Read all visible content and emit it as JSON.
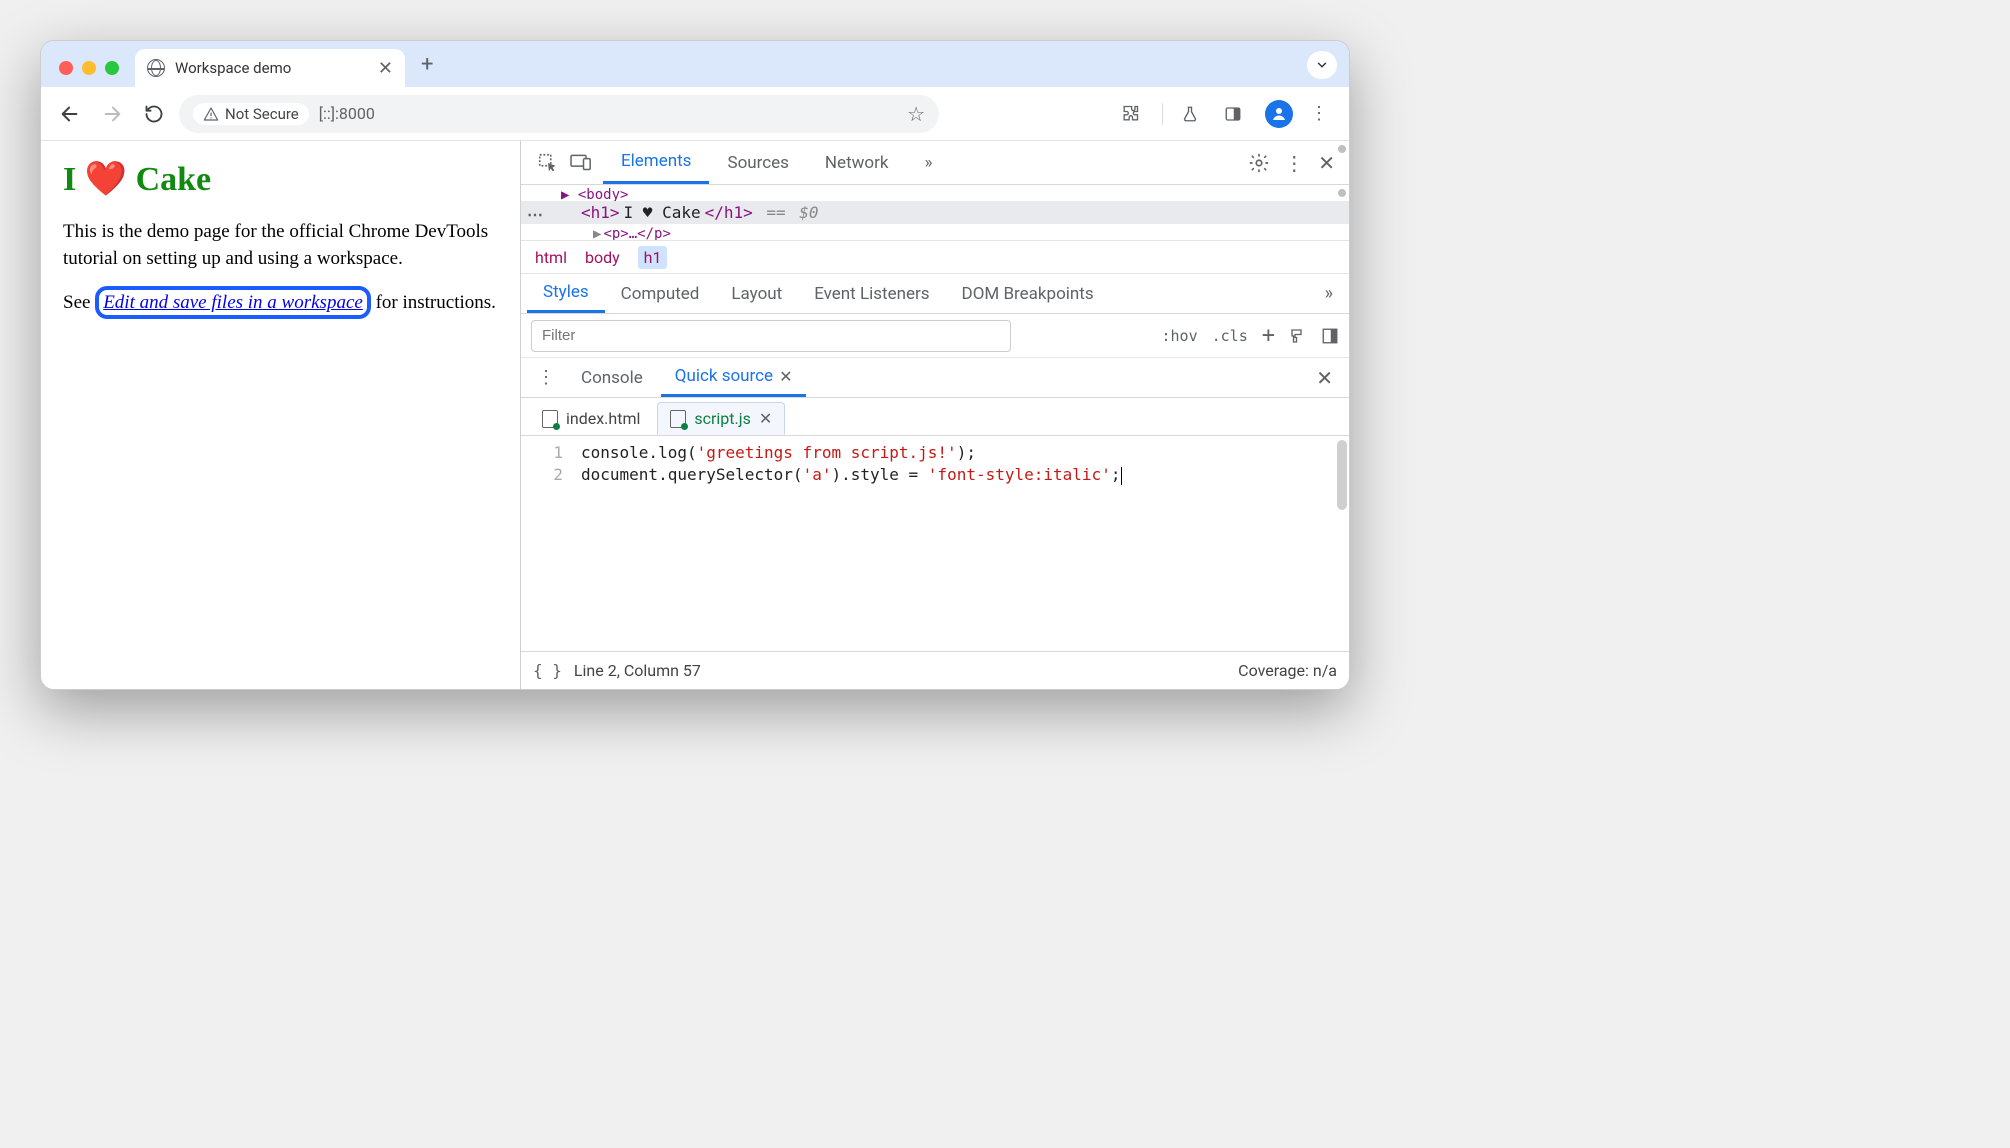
{
  "browser": {
    "tab_title": "Workspace demo",
    "security_label": "Not Secure",
    "url": "[::]:8000"
  },
  "page": {
    "heading": "I ❤️ Cake",
    "paragraph": "This is the demo page for the official Chrome DevTools tutorial on setting up and using a workspace.",
    "link_prefix": "See ",
    "link_text": "Edit and save files in a workspace",
    "link_suffix": " for instructions."
  },
  "devtools": {
    "main_tabs": {
      "elements": "Elements",
      "sources": "Sources",
      "network": "Network",
      "more": "»"
    },
    "dom": {
      "body_open": "<body>",
      "h1_open": "<h1>",
      "h1_text": "I ♥ Cake",
      "h1_close": "</h1>",
      "eq": " == ",
      "selector": "$0",
      "p_partial": "<p>…</p>"
    },
    "breadcrumbs": {
      "html": "html",
      "body": "body",
      "h1": "h1"
    },
    "sub_tabs": {
      "styles": "Styles",
      "computed": "Computed",
      "layout": "Layout",
      "listeners": "Event Listeners",
      "dom_bp": "DOM Breakpoints",
      "more": "»"
    },
    "filter": {
      "placeholder": "Filter",
      "hov": ":hov",
      "cls": ".cls"
    },
    "drawer": {
      "console": "Console",
      "quick_source": "Quick source"
    },
    "files": {
      "index": "index.html",
      "script": "script.js"
    },
    "code": {
      "line1_a": "console.log(",
      "line1_b": "'greetings from script.js!'",
      "line1_c": ");",
      "line2_a": "document.querySelector(",
      "line2_b": "'a'",
      "line2_c": ").style = ",
      "line2_d": "'font-style:italic'",
      "line2_e": ";",
      "num1": "1",
      "num2": "2"
    },
    "status": {
      "pos": "Line 2, Column 57",
      "coverage": "Coverage: n/a"
    }
  }
}
